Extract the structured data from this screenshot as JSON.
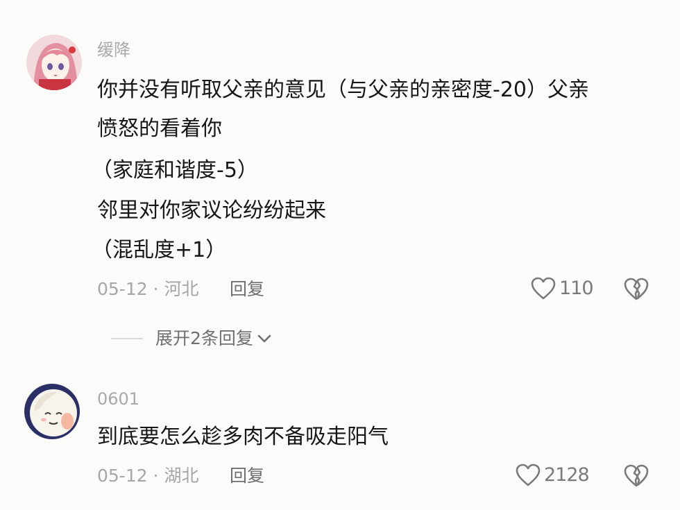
{
  "comments": [
    {
      "username": "缓降",
      "lines": [
        "你并没有听取父亲的意见（与父亲的亲密度-20）父亲",
        "愤怒的看着你",
        "（家庭和谐度-5）",
        "邻里对你家议论纷纷起来",
        "（混乱度+1）"
      ],
      "meta": "05-12 · 河北",
      "reply_label": "回复",
      "like_count": "110",
      "avatar_icon": "anime-girl-avatar-icon"
    },
    {
      "username": "0601",
      "lines": [
        "到底要怎么趁多肉不备吸走阳气"
      ],
      "meta": "05-12 · 湖北",
      "reply_label": "回复",
      "like_count": "2128",
      "avatar_icon": "cartoon-face-avatar-icon"
    }
  ],
  "expand_replies": {
    "label": "展开2条回复",
    "icon": "chevron-down-icon"
  },
  "icons": {
    "like": "heart-outline-icon",
    "dislike": "broken-heart-icon"
  },
  "colors": {
    "background": "#fbfbf9",
    "text_primary": "#161616",
    "text_secondary": "#a6a6a6",
    "text_action": "#6f6f6f"
  }
}
